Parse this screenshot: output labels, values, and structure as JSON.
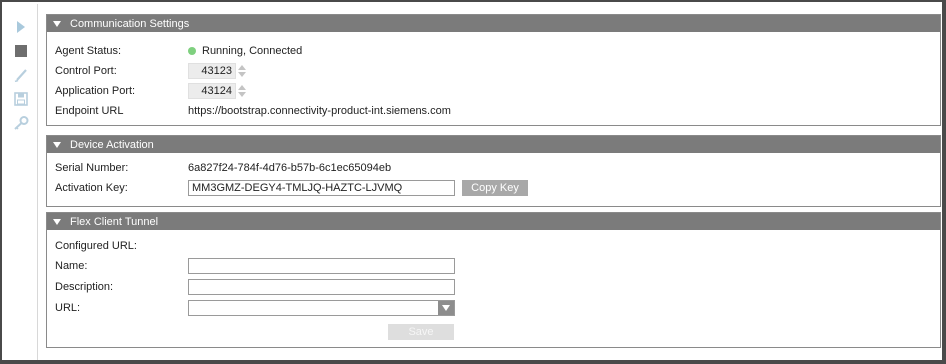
{
  "toolbar": {
    "icons": [
      "play-icon",
      "stop-icon",
      "pencil-icon",
      "save-icon",
      "key-icon"
    ]
  },
  "communication": {
    "header": "Communication Settings",
    "agent_status_label": "Agent Status:",
    "agent_status_value": "Running, Connected",
    "status_color": "#7fd07f",
    "control_port_label": "Control Port:",
    "control_port_value": "43123",
    "application_port_label": "Application Port:",
    "application_port_value": "43124",
    "endpoint_label": "Endpoint URL",
    "endpoint_value": "https://bootstrap.connectivity-product-int.siemens.com"
  },
  "activation": {
    "header": "Device Activation",
    "serial_label": "Serial Number:",
    "serial_value": "6a827f24-784f-4d76-b57b-6c1ec65094eb",
    "key_label": "Activation Key:",
    "key_value": "MM3GMZ-DEGY4-TMLJQ-HAZTC-LJVMQ",
    "copy_button": "Copy Key"
  },
  "tunnel": {
    "header": "Flex Client Tunnel",
    "configured_url_label": "Configured URL:",
    "name_label": "Name:",
    "name_value": "",
    "description_label": "Description:",
    "description_value": "",
    "url_label": "URL:",
    "url_value": "",
    "save_button": "Save"
  },
  "colors": {
    "header_bg": "#7b7b7b",
    "button_bg": "#a8a8a8"
  }
}
